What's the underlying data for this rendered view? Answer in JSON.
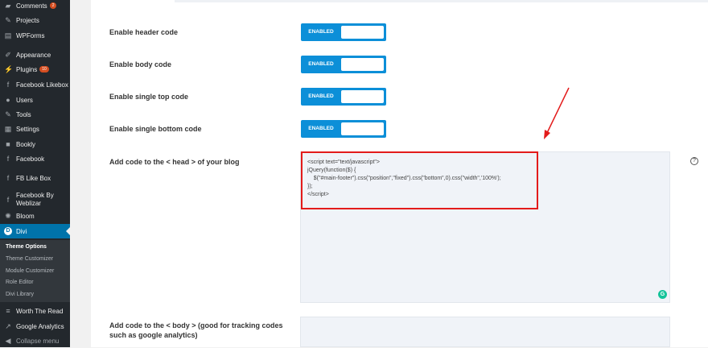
{
  "sidebar": {
    "items": [
      {
        "label": "Comments",
        "badge": "2",
        "icon": "comment-icon"
      },
      {
        "label": "Projects",
        "icon": "pin-icon"
      },
      {
        "label": "WPForms",
        "icon": "form-icon"
      },
      {
        "label": "Appearance",
        "icon": "brush-icon"
      },
      {
        "label": "Plugins",
        "badge": "10",
        "icon": "plugin-icon"
      },
      {
        "label": "Facebook Likebox",
        "icon": "facebook-icon"
      },
      {
        "label": "Users",
        "icon": "user-icon"
      },
      {
        "label": "Tools",
        "icon": "wrench-icon"
      },
      {
        "label": "Settings",
        "icon": "settings-icon"
      },
      {
        "label": "Bookly",
        "icon": "bookly-icon"
      },
      {
        "label": "Facebook",
        "icon": "facebook-icon"
      },
      {
        "label": "FB Like Box",
        "icon": "facebook-icon"
      },
      {
        "label": "Facebook By",
        "label2": "Weblizar",
        "icon": "facebook-icon"
      },
      {
        "label": "Bloom",
        "icon": "bloom-icon"
      },
      {
        "label": "Divi",
        "icon": "divi-icon"
      },
      {
        "label": "Worth The Read",
        "icon": "list-icon"
      },
      {
        "label": "Google Analytics",
        "icon": "chart-icon"
      },
      {
        "label": "Collapse menu",
        "icon": "collapse-icon"
      }
    ],
    "submenu": [
      "Theme Options",
      "Theme Customizer",
      "Module Customizer",
      "Role Editor",
      "Divi Library"
    ]
  },
  "settings": [
    {
      "label": "Enable header code",
      "state": "ENABLED"
    },
    {
      "label": "Enable body code",
      "state": "ENABLED"
    },
    {
      "label": "Enable single top code",
      "state": "ENABLED"
    },
    {
      "label": "Enable single bottom code",
      "state": "ENABLED"
    }
  ],
  "head_code": {
    "label": "Add code to the < head > of your blog",
    "value": "<script text=\"text/javascript\">\njQuery(function($) {\n    $(\"#main-footer\").css(\"position\",\"fixed\").css(\"bottom\",0).css(\"width\",'100%');\n});\n</script>",
    "help": "?",
    "grammarly": "G"
  },
  "body_code": {
    "label": "Add code to the < body > (good for tracking codes such as google analytics)"
  },
  "colors": {
    "accent": "#0c8fd8",
    "highlight": "#e31b1b"
  }
}
